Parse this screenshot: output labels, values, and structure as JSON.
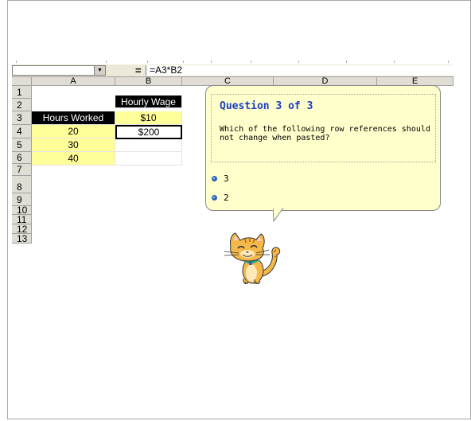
{
  "formula_bar": {
    "name_box": "",
    "equals_sign": "=",
    "formula": "=A3*B2"
  },
  "columns": [
    "A",
    "B",
    "C",
    "D",
    "E"
  ],
  "rows": [
    "1",
    "2",
    "3",
    "4",
    "5",
    "6",
    "7",
    "8",
    "9",
    "10",
    "11",
    "12",
    "13"
  ],
  "cells": {
    "B1": "Hourly Wage",
    "A2": "Hours Worked",
    "B2": "$10",
    "A3": "20",
    "B3": "$200",
    "A4": "30",
    "A5": "40"
  },
  "quiz": {
    "title": "Question 3 of 3",
    "question": "Which of the following row references should not change when pasted?",
    "options": [
      "3",
      "2"
    ]
  },
  "colors": {
    "header_black": "#000000",
    "highlight_yellow": "#ffff99",
    "quiz_title_blue": "#1a3ec4",
    "bubble_bg": "#ffffcc"
  },
  "icons": {
    "dropdown": "chevron-down-icon",
    "radio": "radio-bullet-icon",
    "mascot": "cat-mascot-icon"
  }
}
